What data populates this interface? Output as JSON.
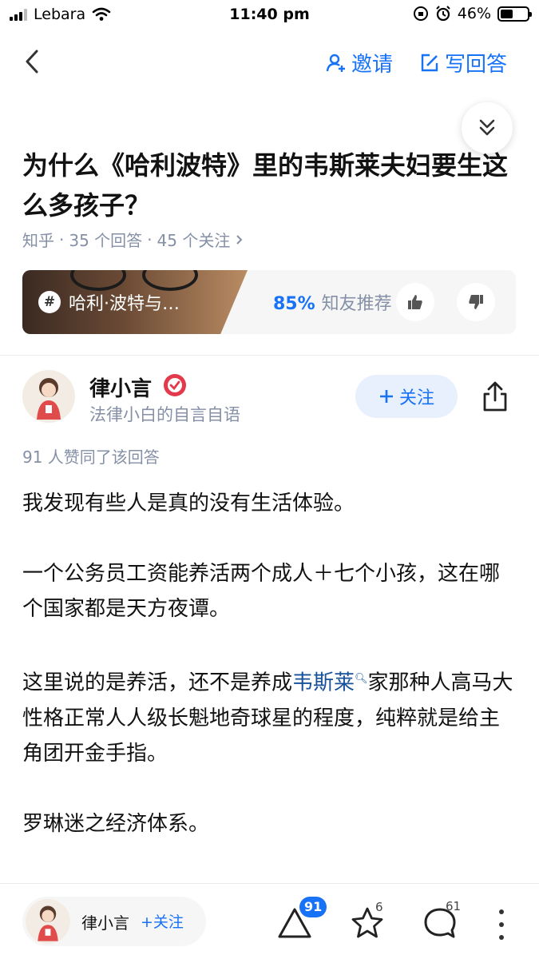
{
  "status_bar": {
    "carrier": "Lebara",
    "time": "11:40 pm",
    "battery": "46%",
    "battery_level": 0.46
  },
  "nav": {
    "invite_label": "邀请",
    "write_answer_label": "写回答"
  },
  "question": {
    "title": "为什么《哈利波特》里的韦斯莱夫妇要生这么多孩子？",
    "source": "知乎",
    "answers_count": "35 个回答",
    "followers_count": "45 个关注"
  },
  "topic_card": {
    "topic": "哈利·波特与…",
    "recommend_pct": "85%",
    "recommend_label": "知友推荐"
  },
  "author": {
    "name": "律小言",
    "bio": "法律小白的自言自语",
    "follow_label": "关注"
  },
  "answer": {
    "likes_line": "91 人赞同了该回答",
    "paragraphs": [
      "我发现有些人是真的没有生活体验。",
      "一个公务员工资能养活两个成人＋七个小孩，这在哪个国家都是天方夜谭。",
      "罗琳迷之经济体系。"
    ],
    "p3_before": "这里说的是养活，还不是养成",
    "p3_link": "韦斯莱",
    "p3_after": "家那种人高马大性格正常人人级长魁地奇球星的程度，纯粹就是给主角团开金手指。"
  },
  "bottom_bar": {
    "author_name": "律小言",
    "follow_label": "+关注",
    "upvotes": "91",
    "favorites": "6",
    "comments": "61"
  },
  "colors": {
    "accent": "#1772f6",
    "meta": "#8590a6",
    "link": "#175199",
    "verified": "#e3394b"
  },
  "icons": [
    "back-arrow-icon",
    "invite-user-icon",
    "edit-icon",
    "chevron-double-down-icon",
    "hash-icon",
    "thumbs-up-icon",
    "thumbs-down-icon",
    "verified-icon",
    "plus-icon",
    "share-icon",
    "search-icon",
    "upvote-triangle-icon",
    "star-icon",
    "comment-icon",
    "more-icon"
  ]
}
